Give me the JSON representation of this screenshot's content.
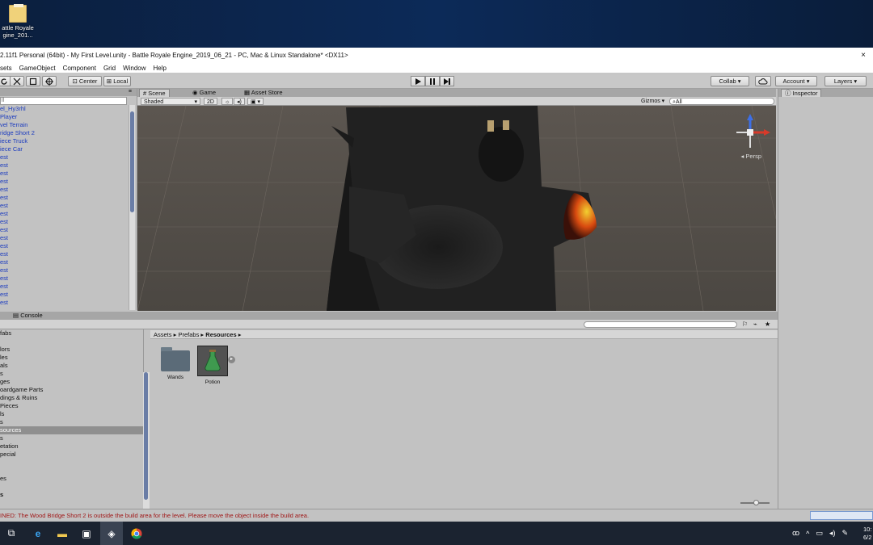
{
  "desktop": {
    "icon_label_1": "attle Royale",
    "icon_label_2": "gine_201..."
  },
  "window": {
    "title": "2.11f1 Personal (64bit) - My First Level.unity - Battle Royale Engine_2019_06_21 - PC, Mac & Linux Standalone* <DX11>",
    "close_glyph": "×"
  },
  "menu": [
    "sets",
    "GameObject",
    "Component",
    "Grid",
    "Window",
    "Help"
  ],
  "toolbar": {
    "pivot": "Center",
    "space": "Local",
    "collab": "Collab ▾",
    "account": "Account ▾",
    "layers": "Layers ▾"
  },
  "hierarchy": {
    "search": "ll",
    "items": [
      "el_Hy3rhl",
      "Player",
      "vel Terrain",
      "ridge Short 2",
      "iece Truck",
      "iece Car",
      "est",
      "est",
      "est",
      "est",
      "est",
      "est",
      "est",
      "est",
      "est",
      "est",
      "est",
      "est",
      "est",
      "est",
      "est",
      "est",
      "est",
      "est",
      "est"
    ]
  },
  "scene": {
    "tabs": {
      "scene": "Scene",
      "game": "Game",
      "asset_store": "Asset Store"
    },
    "shading": "Shaded",
    "mode_2d": "2D",
    "gizmos": "Gizmos ▾",
    "search": "All",
    "persp": "Persp"
  },
  "inspector": {
    "tab": "Inspector"
  },
  "bottom": {
    "console_tab": "Console"
  },
  "project_tree": {
    "items": [
      "fabs",
      "",
      "lors",
      "les",
      "als",
      "s",
      "ges",
      "oardgame Parts",
      "dings & Ruins",
      "Pieces",
      "ls",
      "s",
      "sources",
      "s",
      "etation",
      "pecial",
      "",
      "",
      "es",
      "",
      "s"
    ],
    "selected_index": 12
  },
  "breadcrumb": {
    "part1": "Assets",
    "part2": "Prefabs",
    "part3": "Resources",
    "sep": "▸"
  },
  "assets": [
    {
      "name": "Wands",
      "kind": "folder"
    },
    {
      "name": "Potion",
      "kind": "prefab"
    }
  ],
  "status": {
    "message": "INED: The Wood Bridge Short 2 is outside the build area for the level. Please move the object inside the build area."
  },
  "taskbar": {
    "clock_time": "10:",
    "clock_date": "6/2"
  }
}
